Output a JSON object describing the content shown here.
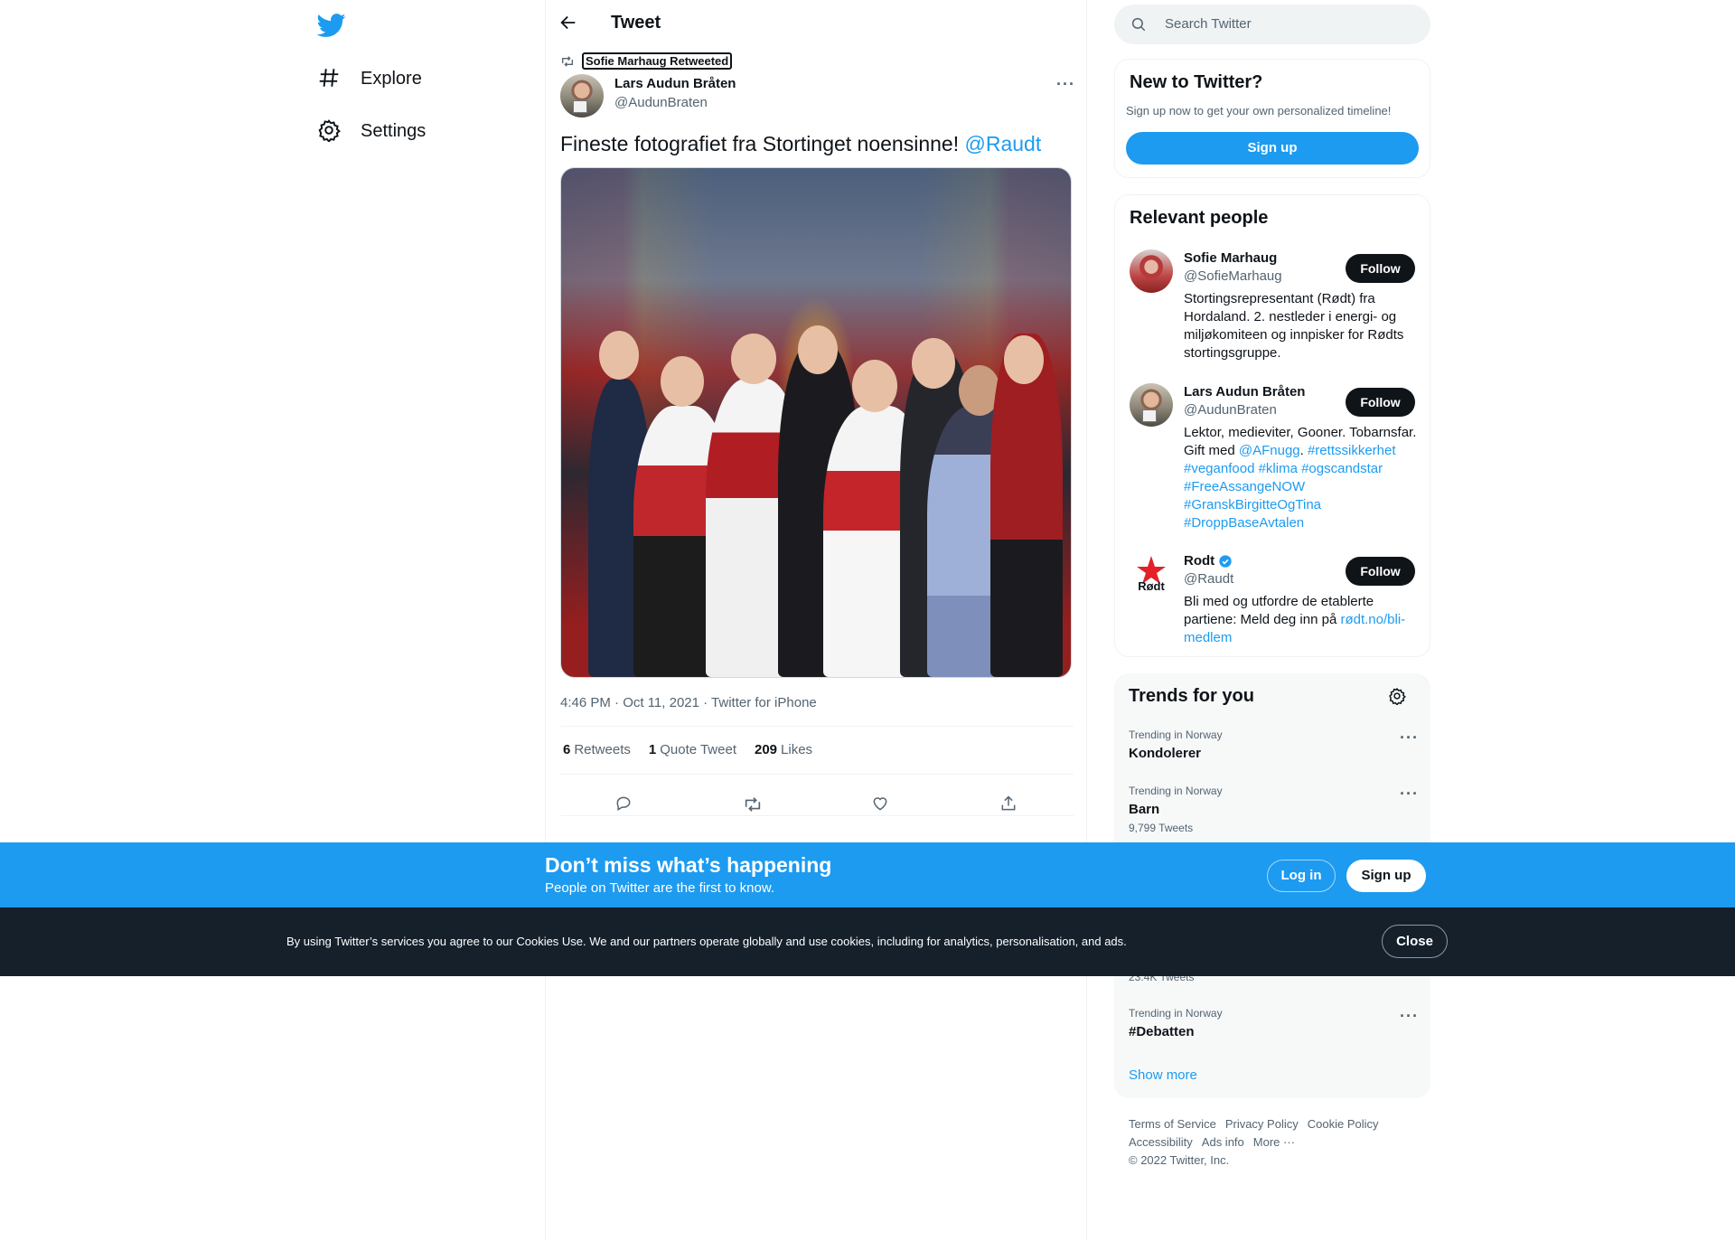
{
  "nav": {
    "logo": "twitter-bird-icon",
    "items": [
      {
        "label": "Explore",
        "icon": "hashtag-icon"
      },
      {
        "label": "Settings",
        "icon": "gear-icon"
      }
    ]
  },
  "header": {
    "title": "Tweet"
  },
  "tweet": {
    "retweeted_by": "Sofie Marhaug Retweeted",
    "author_name": "Lars Audun Bråten",
    "author_handle": "@AudunBraten",
    "text": "Fineste fotografiet fra Stortinget noensinne! ",
    "mention": "@Raudt",
    "meta": "4:46 PM · Oct 11, 2021 · Twitter for iPhone",
    "stats": [
      {
        "count": "6",
        "label": "Retweets"
      },
      {
        "count": "1",
        "label": "Quote Tweet"
      },
      {
        "count": "209",
        "label": "Likes"
      }
    ]
  },
  "search": {
    "placeholder": "Search Twitter"
  },
  "new_to_twitter": {
    "title": "New to Twitter?",
    "subtitle": "Sign up now to get your own personalized timeline!",
    "signup": "Sign up"
  },
  "relevant_people": {
    "title": "Relevant people",
    "follow_label": "Follow",
    "people": [
      {
        "name": "Sofie Marhaug",
        "handle": "@SofieMarhaug",
        "bio": "Stortingsrepresentant (Rødt) fra Hordaland. 2. nestleder i energi- og miljøkomiteen og innpisker for Rødts stortingsgruppe."
      },
      {
        "name": "Lars Audun Bråten",
        "handle": "@AudunBraten",
        "bio_text": "Lektor, medieviter, Gooner. Tobarnsfar. Gift med ",
        "bio_mention": "@AFnugg",
        "bio_dot": ".",
        "bio_tags": "#rettssikkerhet #veganfood #klima #ogscandstar #FreeAssangeNOW #GranskBirgitteOgTina #DroppBaseAvtalen"
      },
      {
        "name": "Rodt",
        "handle": "@Raudt",
        "logo_text": "Rødt",
        "bio_text": "Bli med og utfordre de etablerte partiene: Meld deg inn på ",
        "bio_link": "rødt.no/bli-medlem"
      }
    ]
  },
  "trends": {
    "title": "Trends for you",
    "items": [
      {
        "context": "Trending in Norway",
        "name": "Kondolerer",
        "count": ""
      },
      {
        "context": "Trending in Norway",
        "name": "Barn",
        "count": "9,799 Tweets"
      },
      {
        "context": "",
        "name": "",
        "count": "23.4K Tweets"
      },
      {
        "context": "Trending in Norway",
        "name": "#Debatten",
        "count": ""
      }
    ],
    "show_more": "Show more"
  },
  "footer": {
    "links": [
      "Terms of Service",
      "Privacy Policy",
      "Cookie Policy",
      "Accessibility",
      "Ads info",
      "More ···"
    ],
    "copyright": "© 2022 Twitter, Inc."
  },
  "banner": {
    "title": "Don’t miss what’s happening",
    "subtitle": "People on Twitter are the first to know.",
    "login": "Log in",
    "signup": "Sign up"
  },
  "cookie": {
    "text": "By using Twitter’s services you agree to our Cookies Use. We and our partners operate globally and use cookies, including for analytics, personalisation, and ads.",
    "close": "Close"
  },
  "colors": {
    "accent": "#1d9bf0",
    "text": "#0f1419",
    "muted": "#536471",
    "cookie_bg": "#15202b",
    "rodt_red": "#e4202a"
  }
}
